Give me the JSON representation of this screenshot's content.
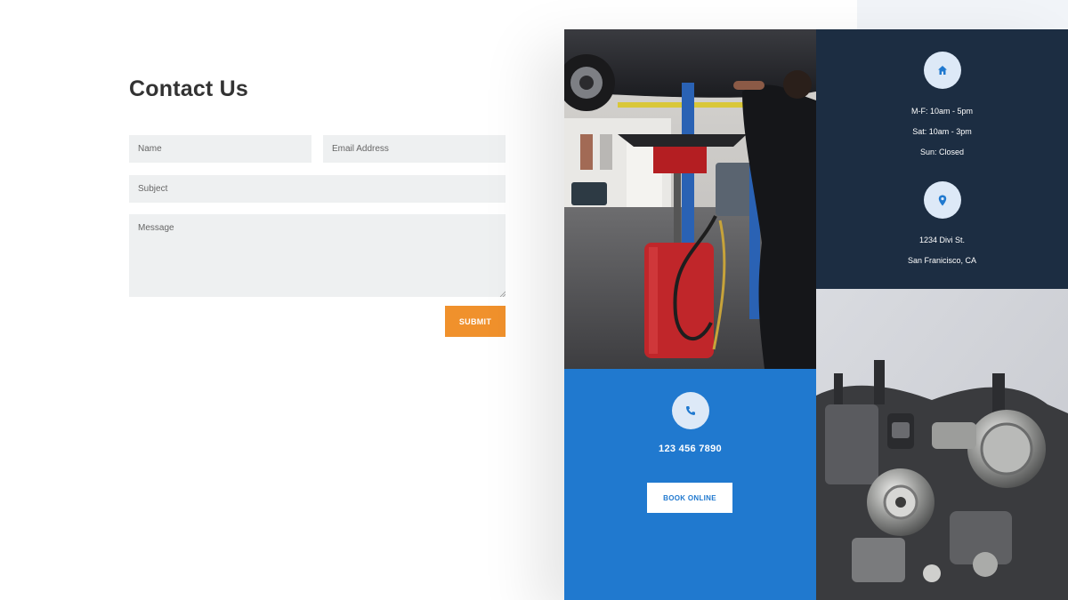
{
  "contact_form": {
    "title": "Contact Us",
    "name_placeholder": "Name",
    "email_placeholder": "Email Address",
    "subject_placeholder": "Subject",
    "message_placeholder": "Message",
    "submit_label": "SUBMIT"
  },
  "hours": {
    "icon": "home-icon",
    "weekdays": "M-F: 10am - 5pm",
    "saturday": "Sat: 10am - 3pm",
    "sunday": "Sun: Closed"
  },
  "address": {
    "icon": "map-pin-icon",
    "street": "1234 Divi St.",
    "city": "San Franicisco, CA"
  },
  "phone": {
    "icon": "phone-icon",
    "number": "123 456 7890",
    "book_label": "BOOK ONLINE"
  },
  "images": {
    "left_photo": "mechanic-under-lifted-car",
    "right_photo": "engine-closeup"
  },
  "colors": {
    "accent_orange": "#f0912c",
    "navy": "#1c2d42",
    "blue": "#2079cf",
    "icon_circle": "#dde9f7",
    "field_bg": "#eef0f1"
  }
}
